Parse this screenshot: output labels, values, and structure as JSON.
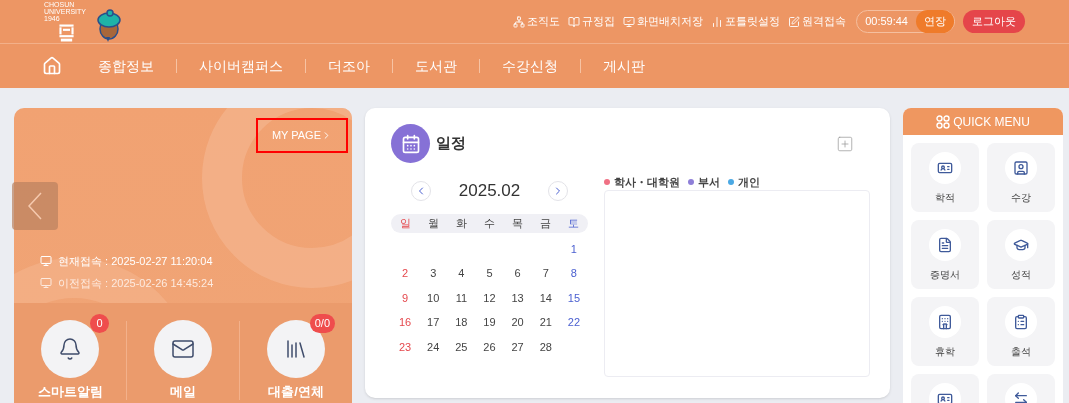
{
  "header": {
    "logo_text": [
      "CHOSUN",
      "UNIVERSITY",
      "1946"
    ],
    "top_links": [
      {
        "label": "조직도"
      },
      {
        "label": "규정집"
      },
      {
        "label": "화면배치저장"
      },
      {
        "label": "포틀릿설정"
      },
      {
        "label": "원격접속"
      }
    ],
    "session": {
      "time": "00:59:44",
      "extend": "연장"
    },
    "logout": "로그아웃"
  },
  "nav": {
    "items": [
      "종합정보",
      "사이버캠퍼스",
      "더조아",
      "도서관",
      "수강신청",
      "게시판"
    ]
  },
  "profile": {
    "my_page": "MY PAGE",
    "access": [
      {
        "label": "현재접속 : 2025-02-27 11:20:04",
        "dimmed": false
      },
      {
        "label": "이전접속 : 2025-02-26 14:45:24",
        "dimmed": true
      }
    ],
    "shortcuts": [
      {
        "label": "스마트알림",
        "badge": "0"
      },
      {
        "label": "메일"
      },
      {
        "label": "대출/연체",
        "badge": "0/0"
      }
    ]
  },
  "schedule": {
    "title": "일정",
    "month": "2025.02",
    "weekdays": [
      {
        "label": "일",
        "kind": "sunday"
      },
      {
        "label": "월",
        "kind": "weekday"
      },
      {
        "label": "화",
        "kind": "weekday"
      },
      {
        "label": "수",
        "kind": "weekday"
      },
      {
        "label": "목",
        "kind": "weekday"
      },
      {
        "label": "금",
        "kind": "weekday"
      },
      {
        "label": "토",
        "kind": "saturday"
      }
    ],
    "weeks": [
      [
        "1"
      ],
      [
        "2",
        "3",
        "4",
        "5",
        "6",
        "7",
        "8"
      ],
      [
        "9",
        "10",
        "11",
        "12",
        "13",
        "14",
        "15"
      ],
      [
        "16",
        "17",
        "18",
        "19",
        "20",
        "21",
        "22"
      ],
      [
        "23",
        "24",
        "25",
        "26",
        "27",
        "28"
      ]
    ],
    "legend": [
      {
        "label": "학사・대학원",
        "color": "#f07184"
      },
      {
        "label": "부서",
        "color": "#8e7fd8"
      },
      {
        "label": "개인",
        "color": "#4ba9e4"
      }
    ]
  },
  "quick_menu": {
    "title": "QUICK MENU",
    "items": [
      {
        "label": "학적"
      },
      {
        "label": "수강"
      },
      {
        "label": "증명서"
      },
      {
        "label": "성적"
      },
      {
        "label": "휴학"
      },
      {
        "label": "출석"
      },
      {
        "cut_off": true
      },
      {
        "cut_off": true
      }
    ]
  }
}
